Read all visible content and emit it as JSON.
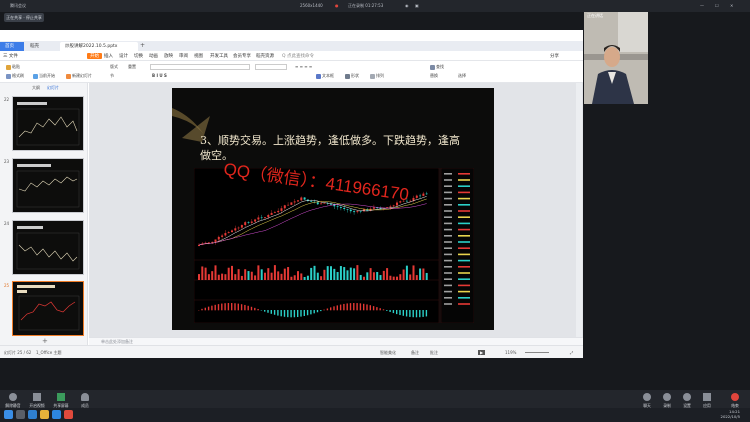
{
  "meeting": {
    "app_name": "腾讯会议",
    "resolution": "2560x1440",
    "recording_label": "正在录制 01:27:53",
    "share_button": "正在共享 · 停止共享",
    "participant_label": "正在讲话"
  },
  "wps": {
    "tabs": {
      "home": "首页",
      "doc": "稻壳",
      "file": "炒股讲解2022.10.5.pptx"
    },
    "search_placeholder": "Q 点此查找命令",
    "menu": {
      "file": "三 文件",
      "start": "开始",
      "insert": "插入",
      "design": "设计",
      "switch": "切换",
      "animation": "动画",
      "show": "放映",
      "review": "审阅",
      "view": "视图",
      "dev": "开发工具",
      "member": "会员专享",
      "resource": "稻壳资源",
      "share": "分享"
    },
    "ribbon": {
      "paste": "粘贴",
      "format": "格式刷",
      "from_current": "当前开始",
      "new_slide": "新建幻灯片",
      "layout": "版式",
      "reset": "重置",
      "section": "节",
      "textbox": "文本框",
      "arrange": "排列",
      "shape": "形状",
      "find": "查找",
      "replace": "替换",
      "select": "选择"
    },
    "panel": {
      "outline": "大纲",
      "slides": "幻灯片"
    },
    "slide_numbers": [
      "22",
      "23",
      "24",
      "25"
    ],
    "slide_title": "3、顺势交易。上涨趋势，逢低做多。下跌趋势，逢高做空。",
    "watermark": "QQ（微信）：411966170",
    "notes_placeholder": "单击此处添加备注",
    "status": {
      "slide_count": "幻灯片 25 / 62",
      "theme": "1_Office 主题",
      "beauty": "智能美化",
      "notes": "备注",
      "comment": "批注",
      "zoom": "119%"
    }
  },
  "toolbar": {
    "buttons": [
      "解除静音",
      "开启视频",
      "共享屏幕",
      "成员",
      "聊天",
      "录制",
      "设置",
      "应用",
      "结束"
    ]
  },
  "clock": {
    "time": "14:21",
    "date": "2022/10/5"
  },
  "colors": {
    "accent": "#3d7de8",
    "wps_orange": "#ff7b16",
    "watermark": "#e1261d",
    "candle_up": "#e53935",
    "candle_down": "#2bd0c8"
  }
}
